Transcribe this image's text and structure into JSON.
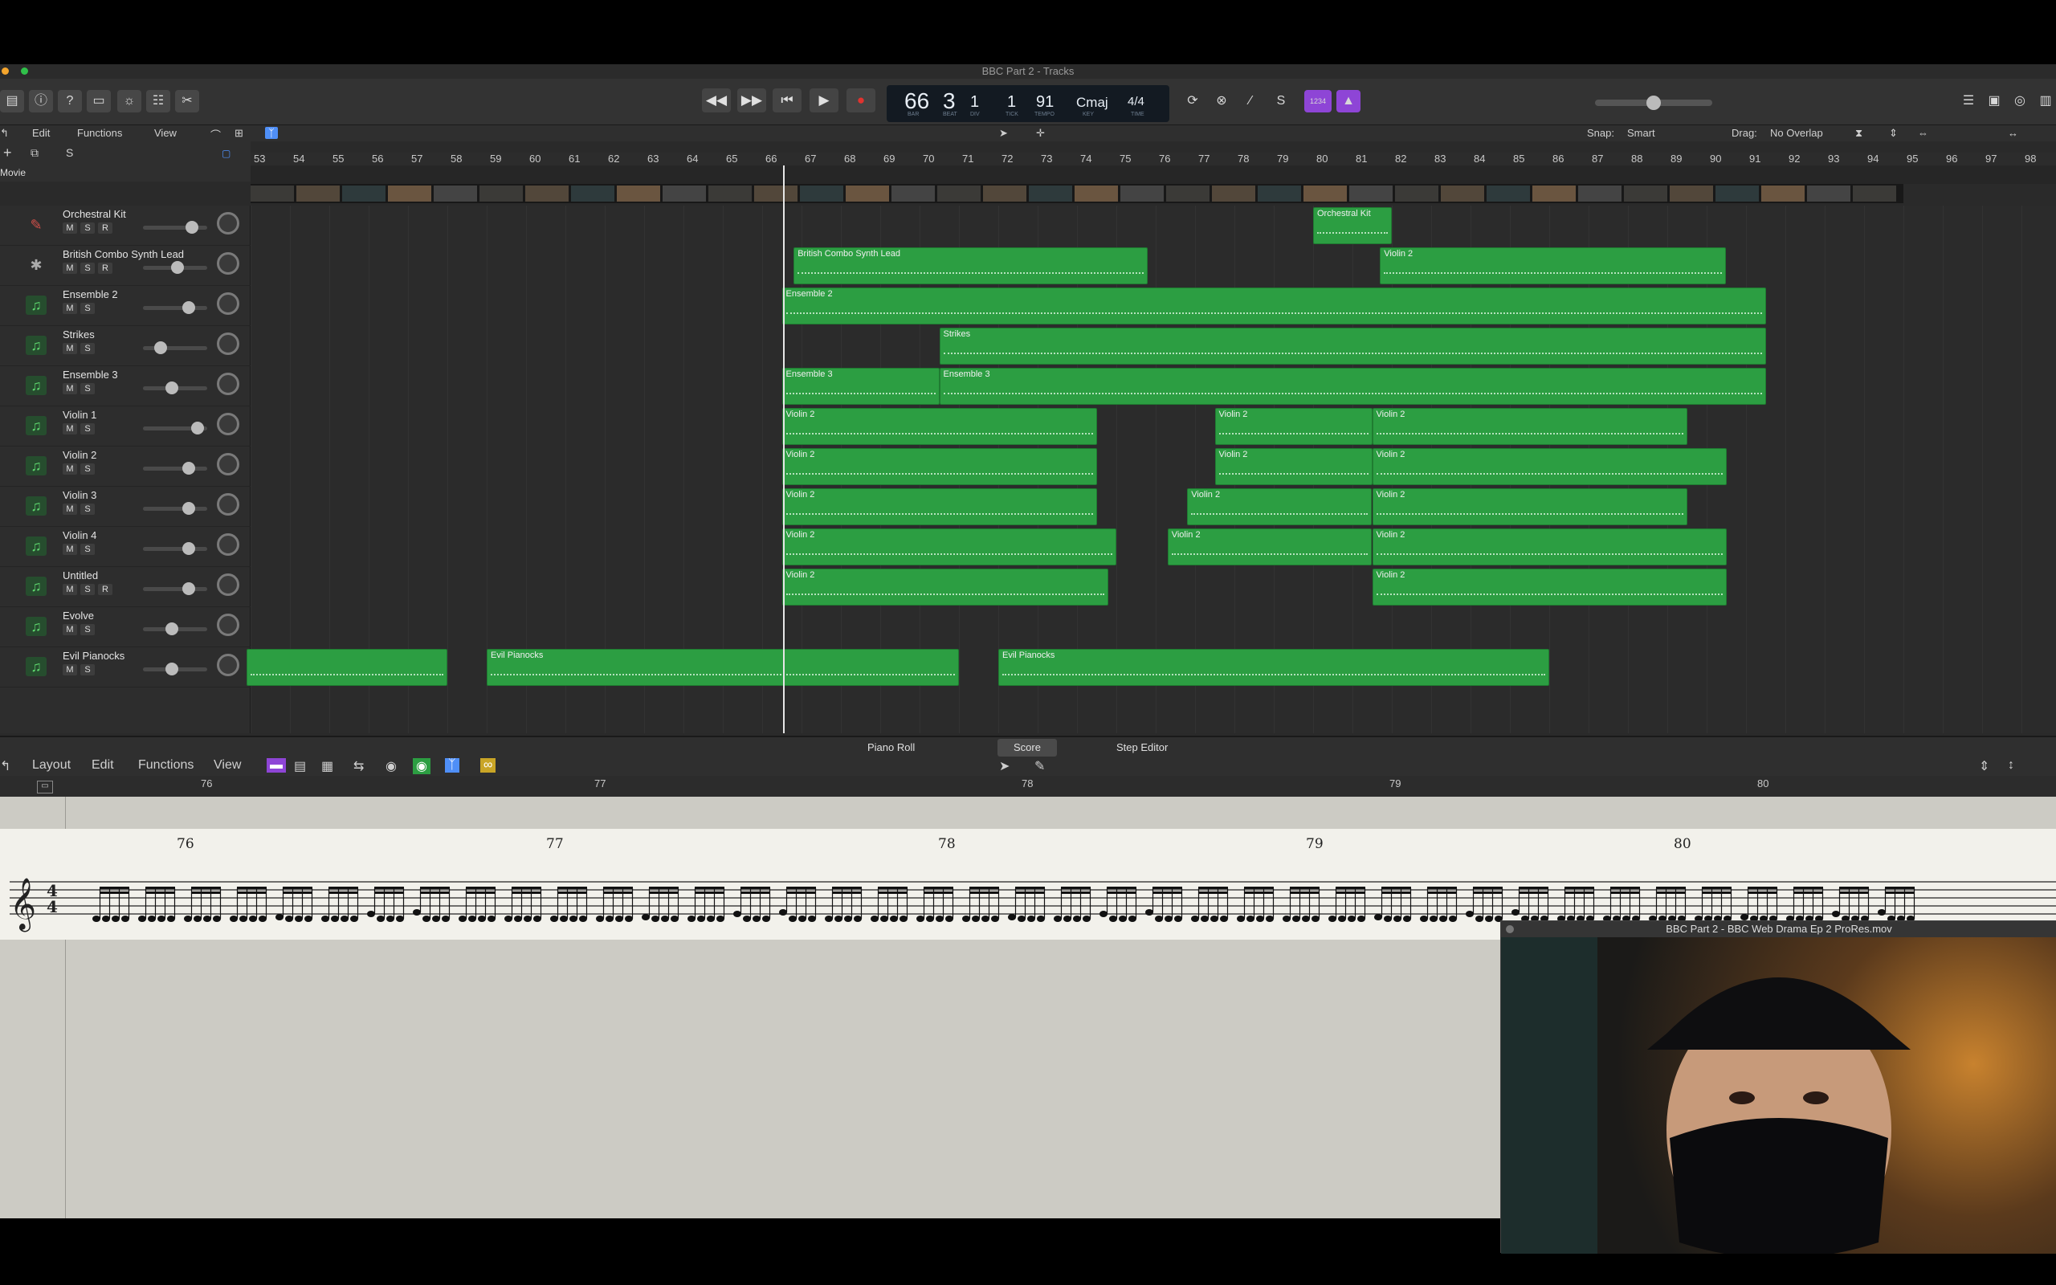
{
  "window": {
    "title": "BBC Part 2 - Tracks"
  },
  "transport": {
    "bar": "66",
    "beat": "3",
    "div": "1",
    "tick": "1",
    "tempo": "91",
    "key": "Cmaj",
    "timesig": "4/4",
    "labels": {
      "bar": "BAR",
      "beat": "BEAT",
      "div": "DIV",
      "tick": "TICK",
      "tempo": "TEMPO",
      "key": "KEY",
      "time": "TIME"
    },
    "count_in": "1234"
  },
  "tracks_toolbar": {
    "edit": "Edit",
    "functions": "Functions",
    "view": "View",
    "snap_label": "Snap:",
    "snap_value": "Smart",
    "drag_label": "Drag:",
    "drag_value": "No Overlap"
  },
  "ruler": [
    "53",
    "54",
    "55",
    "56",
    "57",
    "58",
    "59",
    "60",
    "61",
    "62",
    "63",
    "64",
    "65",
    "66",
    "67",
    "68",
    "69",
    "70",
    "71",
    "72",
    "73",
    "74",
    "75",
    "76",
    "77",
    "78",
    "79",
    "80",
    "81",
    "82",
    "83",
    "84",
    "85",
    "86",
    "87",
    "88",
    "89",
    "90",
    "91",
    "92",
    "93",
    "94",
    "95",
    "96",
    "97",
    "98"
  ],
  "movie_track_label": "Movie",
  "tracks": [
    {
      "name": "Orchestral Kit",
      "icon": "drum-kit-icon",
      "buttons": [
        "M",
        "S",
        "R"
      ],
      "fader": 0.75
    },
    {
      "name": "British Combo Synth Lead",
      "icon": "synth-icon",
      "buttons": [
        "M",
        "S",
        "R"
      ],
      "fader": 0.5
    },
    {
      "name": "Ensemble 2",
      "icon": "music-note-icon",
      "buttons": [
        "M",
        "S"
      ],
      "fader": 0.7
    },
    {
      "name": "Strikes",
      "icon": "music-note-icon",
      "buttons": [
        "M",
        "S"
      ],
      "fader": 0.2
    },
    {
      "name": "Ensemble 3",
      "icon": "music-note-icon",
      "buttons": [
        "M",
        "S"
      ],
      "fader": 0.4
    },
    {
      "name": "Violin 1",
      "icon": "music-note-icon",
      "buttons": [
        "M",
        "S"
      ],
      "fader": 0.85
    },
    {
      "name": "Violin 2",
      "icon": "music-note-icon",
      "buttons": [
        "M",
        "S"
      ],
      "fader": 0.7
    },
    {
      "name": "Violin 3",
      "icon": "music-note-icon",
      "buttons": [
        "M",
        "S"
      ],
      "fader": 0.7
    },
    {
      "name": "Violin 4",
      "icon": "music-note-icon",
      "buttons": [
        "M",
        "S"
      ],
      "fader": 0.7
    },
    {
      "name": "Untitled",
      "icon": "music-note-icon",
      "buttons": [
        "M",
        "S",
        "R"
      ],
      "fader": 0.7
    },
    {
      "name": "Evolve",
      "icon": "music-note-icon",
      "buttons": [
        "M",
        "S"
      ],
      "fader": 0.4
    },
    {
      "name": "Evil Pianocks",
      "icon": "music-note-icon",
      "buttons": [
        "M",
        "S"
      ],
      "fader": 0.4
    }
  ],
  "regions": [
    {
      "track": 0,
      "label": "Orchestral Kit",
      "start": 80.0,
      "end": 82.0
    },
    {
      "track": 1,
      "label": "British Combo Synth Lead",
      "start": 66.8,
      "end": 75.8
    },
    {
      "track": 1,
      "label": "Violin 2",
      "start": 81.7,
      "end": 90.5
    },
    {
      "track": 2,
      "label": "Ensemble 2",
      "start": 66.5,
      "end": 91.5
    },
    {
      "track": 3,
      "label": "Strikes",
      "start": 70.5,
      "end": 91.5
    },
    {
      "track": 4,
      "label": "Ensemble 3",
      "start": 66.5,
      "end": 70.5
    },
    {
      "track": 4,
      "label": "Ensemble 3",
      "start": 70.5,
      "end": 91.5
    },
    {
      "track": 5,
      "label": "Violin 2",
      "start": 66.5,
      "end": 74.5
    },
    {
      "track": 5,
      "label": "Violin 2",
      "start": 77.5,
      "end": 81.5
    },
    {
      "track": 5,
      "label": "Violin 2",
      "start": 81.5,
      "end": 89.5
    },
    {
      "track": 6,
      "label": "Violin 2",
      "start": 66.5,
      "end": 74.5
    },
    {
      "track": 6,
      "label": "Violin 2",
      "start": 77.5,
      "end": 81.5
    },
    {
      "track": 6,
      "label": "Violin 2",
      "start": 81.5,
      "end": 90.5
    },
    {
      "track": 7,
      "label": "Violin 2",
      "start": 66.5,
      "end": 74.5
    },
    {
      "track": 7,
      "label": "Violin 2",
      "start": 76.8,
      "end": 81.5
    },
    {
      "track": 7,
      "label": "Violin 2",
      "start": 81.5,
      "end": 89.5
    },
    {
      "track": 8,
      "label": "Violin 2",
      "start": 66.5,
      "end": 75.0
    },
    {
      "track": 8,
      "label": "Violin 2",
      "start": 76.3,
      "end": 81.5
    },
    {
      "track": 8,
      "label": "Violin 2",
      "start": 81.5,
      "end": 90.5
    },
    {
      "track": 9,
      "label": "Violin 2",
      "start": 66.5,
      "end": 74.8
    },
    {
      "track": 9,
      "label": "Violin 2",
      "start": 81.5,
      "end": 90.5
    },
    {
      "track": 11,
      "label": "",
      "start": 52.9,
      "end": 58.0
    },
    {
      "track": 11,
      "label": "Evil Pianocks",
      "start": 59.0,
      "end": 71.0
    },
    {
      "track": 11,
      "label": "Evil Pianocks",
      "start": 72.0,
      "end": 86.0
    }
  ],
  "editor_tabs": [
    "Piano Roll",
    "Score",
    "Step Editor"
  ],
  "editor_active_tab": "Score",
  "editor_toolbar": {
    "layout": "Layout",
    "edit": "Edit",
    "functions": "Functions",
    "view": "View"
  },
  "editor_ruler": [
    "76",
    "77",
    "78",
    "79",
    "80"
  ],
  "score_bars": [
    "76",
    "77",
    "78",
    "79",
    "80"
  ],
  "score_timesig": "4/4",
  "movie_window": {
    "title": "BBC Part 2 - BBC Web Drama Ep 2 ProRes.mov"
  },
  "colors": {
    "region": "#2c9e42",
    "accent": "#4f8ff7",
    "record": "#e0332f"
  }
}
